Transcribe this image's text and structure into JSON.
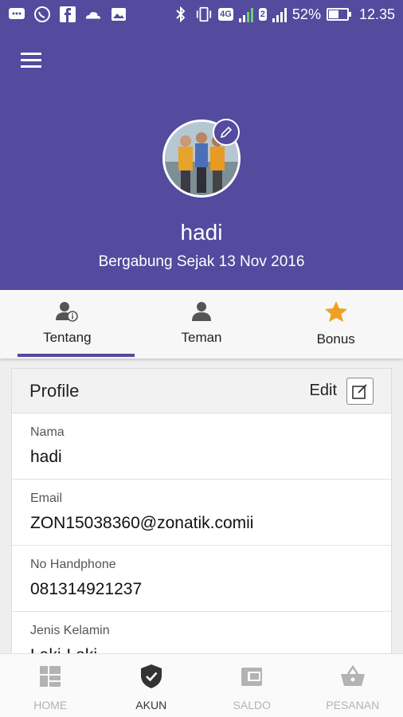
{
  "status_bar": {
    "battery": "52%",
    "battery_level": 0.52,
    "time": "12.35",
    "network": "4G",
    "sim2": "2"
  },
  "profile_header": {
    "name": "hadi",
    "joined": "Bergabung Sejak 13 Nov 2016"
  },
  "tabs": [
    {
      "label": "Tentang",
      "icon": "person-info-icon"
    },
    {
      "label": "Teman",
      "icon": "person-icon"
    },
    {
      "label": "Bonus",
      "icon": "star-icon"
    }
  ],
  "profile": {
    "title": "Profile",
    "edit_label": "Edit",
    "fields": [
      {
        "label": "Nama",
        "value": "hadi"
      },
      {
        "label": "Email",
        "value": "ZON15038360@zonatik.comii"
      },
      {
        "label": "No Handphone",
        "value": "081314921237"
      },
      {
        "label": "Jenis Kelamin",
        "value": "Laki-Laki"
      }
    ]
  },
  "bottom_nav": [
    {
      "label": "HOME",
      "icon": "home-grid-icon"
    },
    {
      "label": "AKUN",
      "icon": "shield-check-icon"
    },
    {
      "label": "SALDO",
      "icon": "wallet-icon"
    },
    {
      "label": "PESANAN",
      "icon": "basket-icon"
    }
  ],
  "colors": {
    "primary": "#544a9e",
    "star": "#f0a020",
    "inactive": "#b3b3b3"
  }
}
